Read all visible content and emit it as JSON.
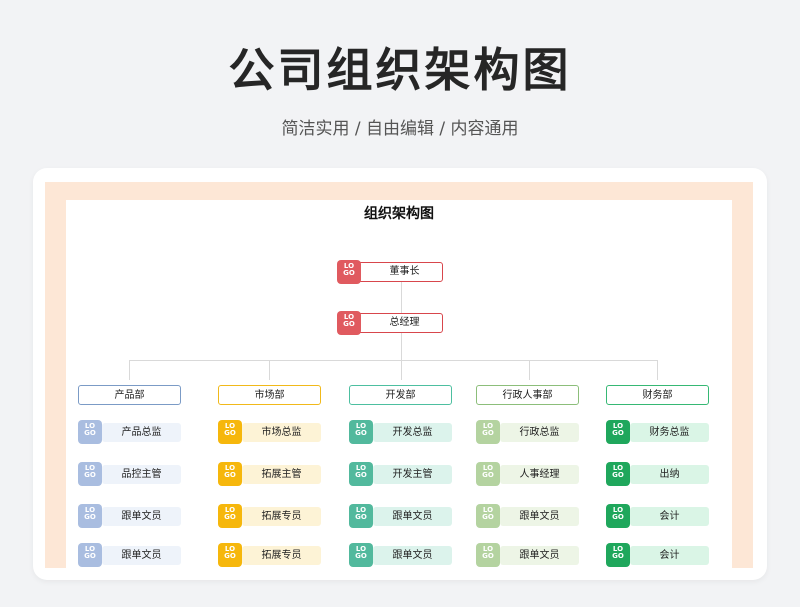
{
  "hero": {
    "title": "公司组织架构图",
    "subtitle": "简洁实用 / 自由编辑 / 内容通用"
  },
  "chart": {
    "title": "组织架构图",
    "logo_text": [
      "LO",
      "GO"
    ],
    "top": [
      {
        "label": "董事长",
        "color": "#e05a5f"
      },
      {
        "label": "总经理",
        "color": "#e05a5f"
      }
    ],
    "departments": [
      {
        "name": "产品部",
        "border": "#7b9bc6",
        "logo": "#a9bde0",
        "pill": "#eef3fa",
        "roles": [
          "产品总监",
          "品控主管",
          "跟单文员",
          "跟单文员"
        ]
      },
      {
        "name": "市场部",
        "border": "#f1b91a",
        "logo": "#f6b70c",
        "pill": "#fdf3d6",
        "roles": [
          "市场总监",
          "拓展主管",
          "拓展专员",
          "拓展专员"
        ]
      },
      {
        "name": "开发部",
        "border": "#4dbfa0",
        "logo": "#52b99d",
        "pill": "#dcf3ec",
        "roles": [
          "开发总监",
          "开发主管",
          "跟单文员",
          "跟单文员"
        ]
      },
      {
        "name": "行政人事部",
        "border": "#8cbe7a",
        "logo": "#b4d3a0",
        "pill": "#edf5e6",
        "roles": [
          "行政总监",
          "人事经理",
          "跟单文员",
          "跟单文员"
        ]
      },
      {
        "name": "财务部",
        "border": "#36b874",
        "logo": "#1fa75c",
        "pill": "#daf5e6",
        "roles": [
          "财务总监",
          "出纳",
          "会计",
          "会计"
        ]
      }
    ]
  }
}
